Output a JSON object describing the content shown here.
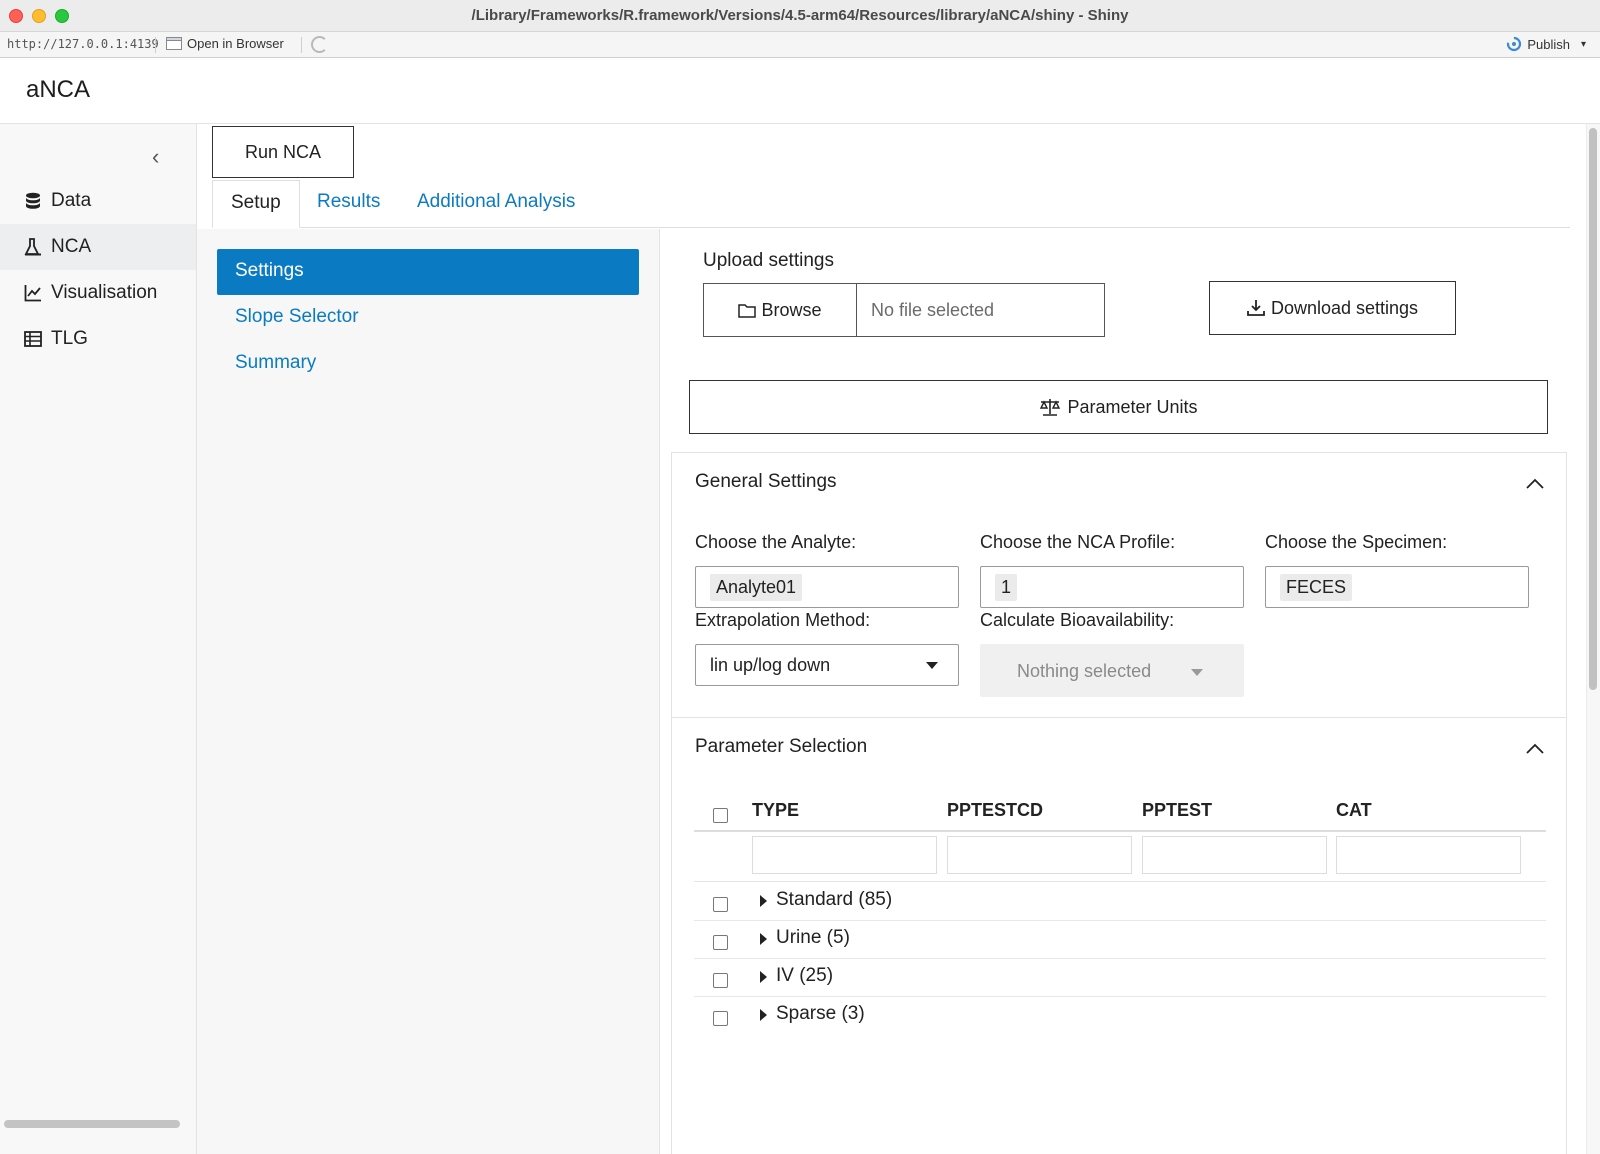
{
  "window": {
    "title": "/Library/Frameworks/R.framework/Versions/4.5-arm64/Resources/library/aNCA/shiny - Shiny"
  },
  "viewer": {
    "url": "http://127.0.0.1:4139",
    "open_in_browser": "Open in Browser",
    "publish": "Publish"
  },
  "app": {
    "brand": "aNCA"
  },
  "sidebar": {
    "items": [
      {
        "label": "Data",
        "icon": "database-icon"
      },
      {
        "label": "NCA",
        "icon": "flask-icon"
      },
      {
        "label": "Visualisation",
        "icon": "line-chart-icon"
      },
      {
        "label": "TLG",
        "icon": "table-icon"
      }
    ],
    "active": "NCA"
  },
  "main": {
    "run_nca": "Run NCA",
    "tabs": [
      {
        "label": "Setup"
      },
      {
        "label": "Results"
      },
      {
        "label": "Additional Analysis"
      }
    ],
    "active_tab": "Setup",
    "pills": [
      {
        "label": "Settings"
      },
      {
        "label": "Slope Selector"
      },
      {
        "label": "Summary"
      }
    ],
    "active_pill": "Settings"
  },
  "settings": {
    "upload_label": "Upload settings",
    "browse": "Browse",
    "no_file": "No file selected",
    "download": "Download settings",
    "parameter_units": "Parameter Units",
    "general": {
      "title": "General Settings",
      "analyte_label": "Choose the Analyte:",
      "analyte_value": "Analyte01",
      "profile_label": "Choose the NCA Profile:",
      "profile_value": "1",
      "specimen_label": "Choose the Specimen:",
      "specimen_value": "FECES",
      "extrap_label": "Extrapolation Method:",
      "extrap_value": "lin up/log down",
      "bioavail_label": "Calculate Bioavailability:",
      "bioavail_value": "Nothing selected"
    },
    "params": {
      "title": "Parameter Selection",
      "columns": [
        "TYPE",
        "PPTESTCD",
        "PPTEST",
        "CAT"
      ],
      "groups": [
        {
          "label": "Standard (85)"
        },
        {
          "label": "Urine (5)"
        },
        {
          "label": "IV (25)"
        },
        {
          "label": "Sparse (3)"
        }
      ]
    }
  },
  "colors": {
    "accent": "#0a7ac3",
    "link": "#0b7bc1"
  }
}
